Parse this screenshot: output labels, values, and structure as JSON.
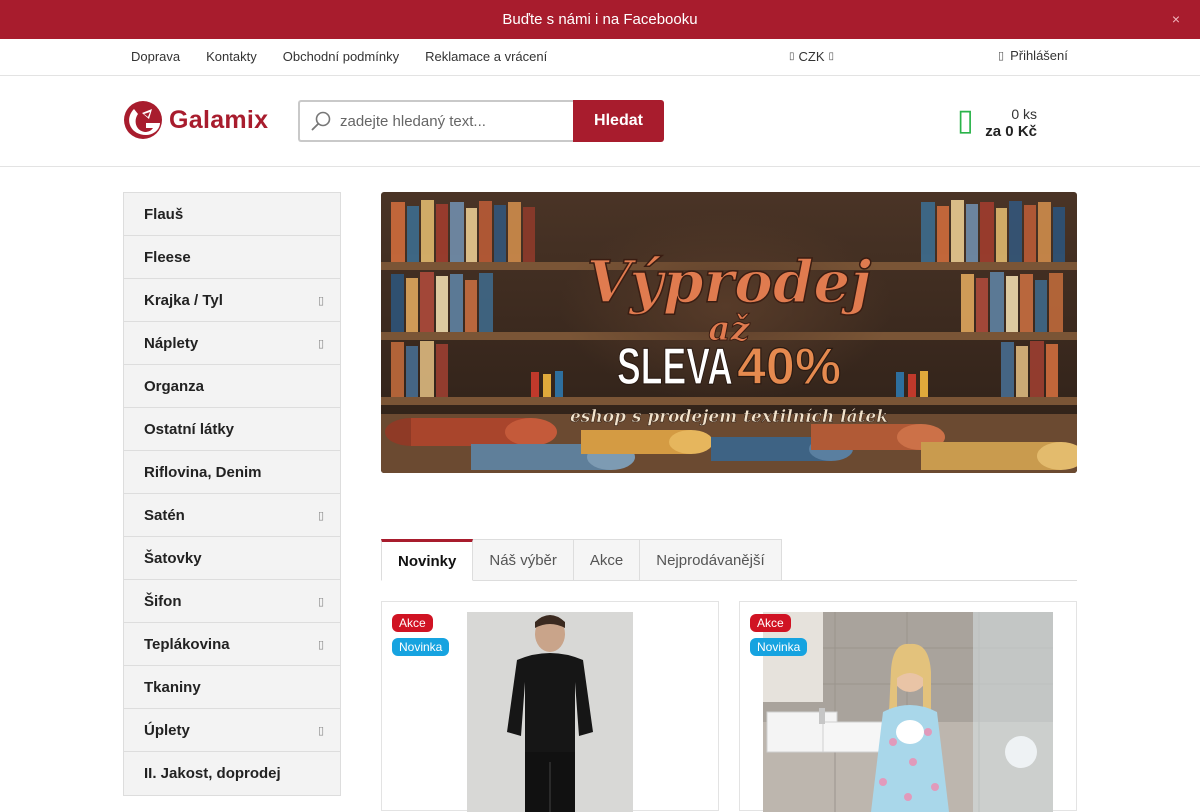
{
  "promo": {
    "text": "Buďte s námi i na Facebooku",
    "close_glyph": "×"
  },
  "top_nav": {
    "links": [
      "Doprava",
      "Kontakty",
      "Obchodní podmínky",
      "Reklamace a vrácení"
    ],
    "currency": "CZK",
    "login": "Přihlášení"
  },
  "header": {
    "logo_text": "Galamix",
    "search_placeholder": "zadejte hledaný text...",
    "search_button": "Hledat",
    "cart_count": "0 ks",
    "cart_total": "za 0 Kč"
  },
  "categories": [
    {
      "label": "Flauš",
      "has_submenu": false
    },
    {
      "label": "Fleese",
      "has_submenu": false
    },
    {
      "label": "Krajka / Tyl",
      "has_submenu": true
    },
    {
      "label": "Náplety",
      "has_submenu": true
    },
    {
      "label": "Organza",
      "has_submenu": false
    },
    {
      "label": "Ostatní látky",
      "has_submenu": false
    },
    {
      "label": "Riflovina, Denim",
      "has_submenu": false
    },
    {
      "label": "Satén",
      "has_submenu": true
    },
    {
      "label": "Šatovky",
      "has_submenu": false
    },
    {
      "label": "Šifon",
      "has_submenu": true
    },
    {
      "label": "Teplákovina",
      "has_submenu": true
    },
    {
      "label": "Tkaniny",
      "has_submenu": false
    },
    {
      "label": "Úplety",
      "has_submenu": true
    },
    {
      "label": "II. Jakost, doprodej",
      "has_submenu": false
    }
  ],
  "banner": {
    "line1": "Výprodej",
    "line2": "až",
    "line3": "SLEVA 40%",
    "tagline": "eshop s prodejem textilních látek"
  },
  "tabs": [
    {
      "label": "Novinky",
      "active": true
    },
    {
      "label": "Náš výběr",
      "active": false
    },
    {
      "label": "Akce",
      "active": false
    },
    {
      "label": "Nejprodávanější",
      "active": false
    }
  ],
  "products": [
    {
      "badges": [
        "Akce",
        "Novinka"
      ]
    },
    {
      "badges": [
        "Akce",
        "Novinka"
      ]
    }
  ],
  "colors": {
    "brand": "#a81c2d",
    "cart": "#2ab34a",
    "badge_akce": "#d01323",
    "badge_novinka": "#16a3e0"
  },
  "icons": {
    "search": "magnifier-icon",
    "cart": "cart-icon",
    "user": "user-icon",
    "chevron": "chevron-right-icon"
  }
}
